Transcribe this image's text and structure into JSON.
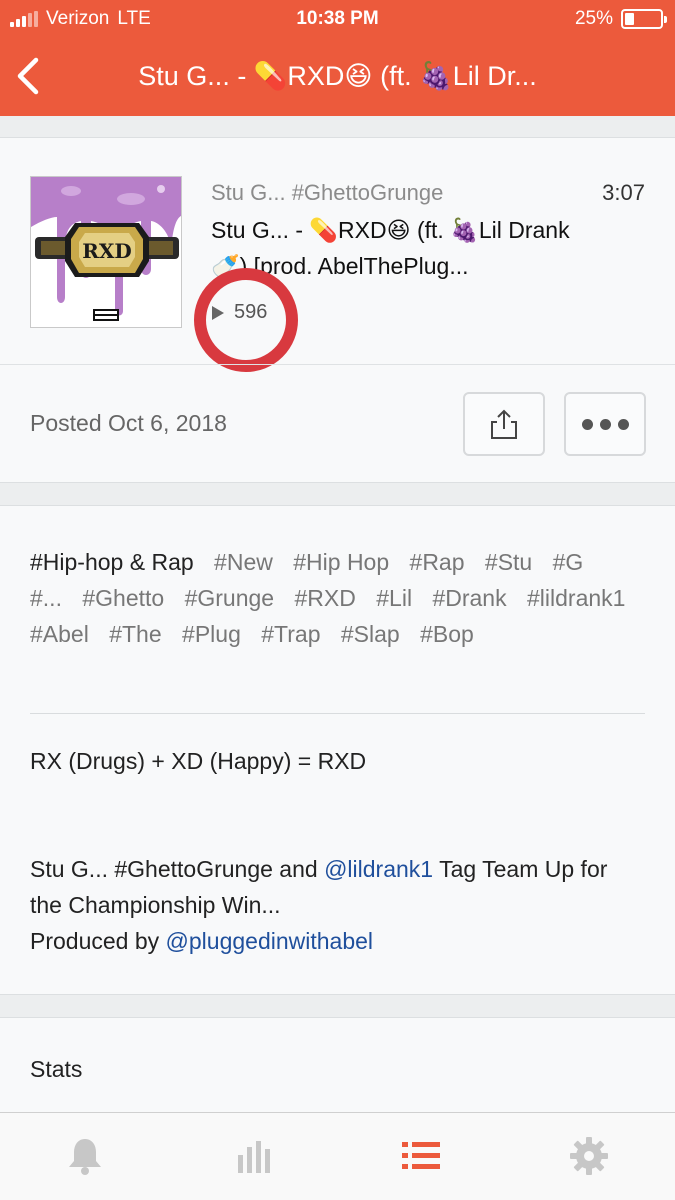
{
  "status_bar": {
    "carrier": "Verizon",
    "network": "LTE",
    "time": "10:38 PM",
    "battery": "25%",
    "battery_level": 0.25
  },
  "nav": {
    "back_icon": "chevron-left-icon",
    "title": "Stu G... - 💊RXD😆 (ft. 🍇Lil Dr..."
  },
  "track": {
    "artwork_text": "RXD",
    "artist": "Stu G... #GhettoGrunge",
    "duration": "3:07",
    "title": "Stu G... - 💊RXD😆 (ft. 🍇Lil Drank 🍼) [prod. AbelThePlug...",
    "plays": "596",
    "posted_label": "Posted",
    "posted_date": "Oct 6, 2018"
  },
  "tags": {
    "genre": "#Hip-hop & Rap",
    "items": [
      "#New",
      "#Hip Hop",
      "#Rap",
      "#Stu",
      "#G",
      "#...",
      "#Ghetto",
      "#Grunge",
      "#RXD",
      "#Lil",
      "#Drank",
      "#lildrank1",
      "#Abel",
      "#The",
      "#Plug",
      "#Trap",
      "#Slap",
      "#Bop"
    ]
  },
  "description": {
    "line1": "RX (Drugs) + XD (Happy) = RXD",
    "line2_pre": "Stu G... #GhettoGrunge and ",
    "mention1": "@lildrank1",
    "line2_post": " Tag Team Up for the Championship Win...",
    "produced_by": "Produced by ",
    "mention2": "@pluggedinwithabel"
  },
  "stats": {
    "label": "Stats"
  },
  "tabbar": {
    "items": [
      "bell-icon",
      "bar-chart-icon",
      "list-icon",
      "gear-icon"
    ],
    "active_index": 2
  },
  "colors": {
    "accent": "#ec5a3c",
    "highlight_circle": "#d8393f",
    "link": "#1f4f9c",
    "tab_inactive": "#c7c7c7"
  }
}
